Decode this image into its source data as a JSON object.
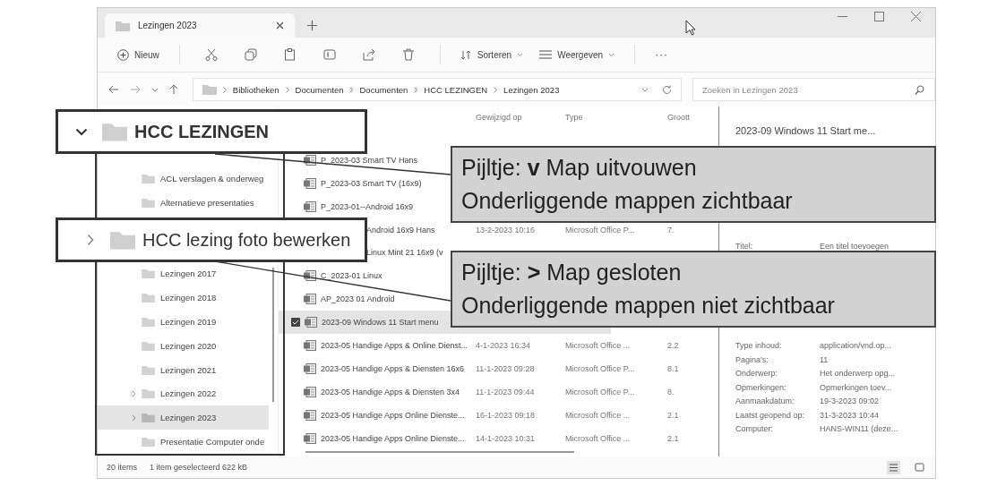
{
  "window": {
    "tab": {
      "title": "Lezingen 2023",
      "selected": true
    }
  },
  "toolbar": {
    "new": "Nieuw",
    "sort": "Sorteren",
    "view": "Weergeven",
    "more": "···"
  },
  "address": {
    "breadcrumb": [
      "Bibliotheken",
      "Documenten",
      "Documenten",
      "HCC LEZINGEN",
      "Lezingen 2023"
    ],
    "search_placeholder": "Zoeken in Lezingen 2023"
  },
  "nav": {
    "items": [
      {
        "label": "ACL verslagen & onderweg",
        "has_children": false,
        "selected": false
      },
      {
        "label": "Alternatieve presentaties",
        "has_children": false,
        "selected": false
      },
      {
        "label": "Lezingen 2017",
        "has_children": false,
        "selected": false
      },
      {
        "label": "Lezingen 2018",
        "has_children": false,
        "selected": false
      },
      {
        "label": "Lezingen 2019",
        "has_children": false,
        "selected": false
      },
      {
        "label": "Lezingen 2020",
        "has_children": false,
        "selected": false
      },
      {
        "label": "Lezingen 2021",
        "has_children": false,
        "selected": false
      },
      {
        "label": "Lezingen 2022",
        "has_children": true,
        "selected": false
      },
      {
        "label": "Lezingen 2023",
        "has_children": true,
        "selected": true
      },
      {
        "label": "Presentatie Computer onde",
        "has_children": false,
        "selected": false
      }
    ]
  },
  "list": {
    "columns": [
      "Gewijzigd op",
      "Type",
      "Groott"
    ],
    "rows": [
      {
        "kind": "hidden",
        "selected": false
      },
      {
        "kind": "file",
        "name": "P_2023-03 Smart TV Hans",
        "selected": false
      },
      {
        "kind": "file",
        "name": "P_2023-03 Smart TV (16x9)",
        "selected": false
      },
      {
        "kind": "file",
        "name": "P_2023-01--Android 16x9",
        "selected": false
      },
      {
        "kind": "partial",
        "name": "Android 16x9 Hans",
        "date": "13-2-2023 10:16",
        "type": "Microsoft Office P...",
        "size": "7.",
        "selected": false
      },
      {
        "kind": "partial",
        "name": "Linux Mint 21 16x9 (v",
        "selected": false
      },
      {
        "kind": "file",
        "name": "C_2023-01 Linux",
        "selected": false
      },
      {
        "kind": "file",
        "name": "AP_2023 01 Android",
        "selected": false
      },
      {
        "kind": "file",
        "name": "2023-09 Windows 11 Start menu",
        "selected": true
      },
      {
        "kind": "file",
        "name": "2023-05 Handige Apps & Online Dienst...",
        "date": "4-1-2023 16:34",
        "type": "Microsoft Office ...",
        "size": "2.2",
        "selected": false
      },
      {
        "kind": "file",
        "name": "2023-05 Handige Apps & Diensten 16x6",
        "date": "11-1-2023 09:28",
        "type": "Microsoft Office P...",
        "size": "8.1",
        "selected": false
      },
      {
        "kind": "file",
        "name": "2023-05 Handige Apps & Diensten 3x4",
        "date": "11-1-2023 09:44",
        "type": "Microsoft Office P...",
        "size": "8.",
        "selected": false
      },
      {
        "kind": "file",
        "name": "2023-05 Handige Apps  Online Dienste...",
        "date": "16-1-2023 09:18",
        "type": "Microsoft Office ...",
        "size": "2.1",
        "selected": false
      },
      {
        "kind": "file",
        "name": "2023-05 Handige Apps  Online Dienste...",
        "date": "14-1-2023 10:31",
        "type": "Microsoft Office ...",
        "size": "2.1",
        "selected": false
      }
    ]
  },
  "details": {
    "title": "2023-09 Windows 11 Start me...",
    "title_field": {
      "label": "Titel:",
      "value": "Een titel toevoegen"
    },
    "properties": [
      {
        "label": "Type inhoud:",
        "value": "application/vnd.op..."
      },
      {
        "label": "Pagina's:",
        "value": "11"
      },
      {
        "label": "Onderwerp:",
        "value": "Het onderwerp opg..."
      },
      {
        "label": "Opmerkingen:",
        "value": "Opmerkingen toev..."
      },
      {
        "label": "Aanmaakdatum:",
        "value": "19-3-2023 09:02"
      },
      {
        "label": "Laatst geopend op:",
        "value": "31-3-2023 10:44"
      },
      {
        "label": "Computer:",
        "value": "HANS-WIN11 (deze..."
      }
    ]
  },
  "status_bar": {
    "count": "20 items",
    "selection": "1 item geselecteerd  622 kB"
  },
  "zoomed_folders": [
    {
      "label": "HCC LEZINGEN",
      "expanded": true
    },
    {
      "label": "HCC lezing foto bewerken",
      "expanded": false
    }
  ],
  "callouts": [
    {
      "line1": "Pijltje:  **v** Map uitvouwen",
      "line2": "Onderliggende  mappen  zichtbaar"
    },
    {
      "line1": "Pijltje:  **>** Map gesloten",
      "line2": "Onderliggende  mappen  niet  zichtbaar"
    }
  ]
}
